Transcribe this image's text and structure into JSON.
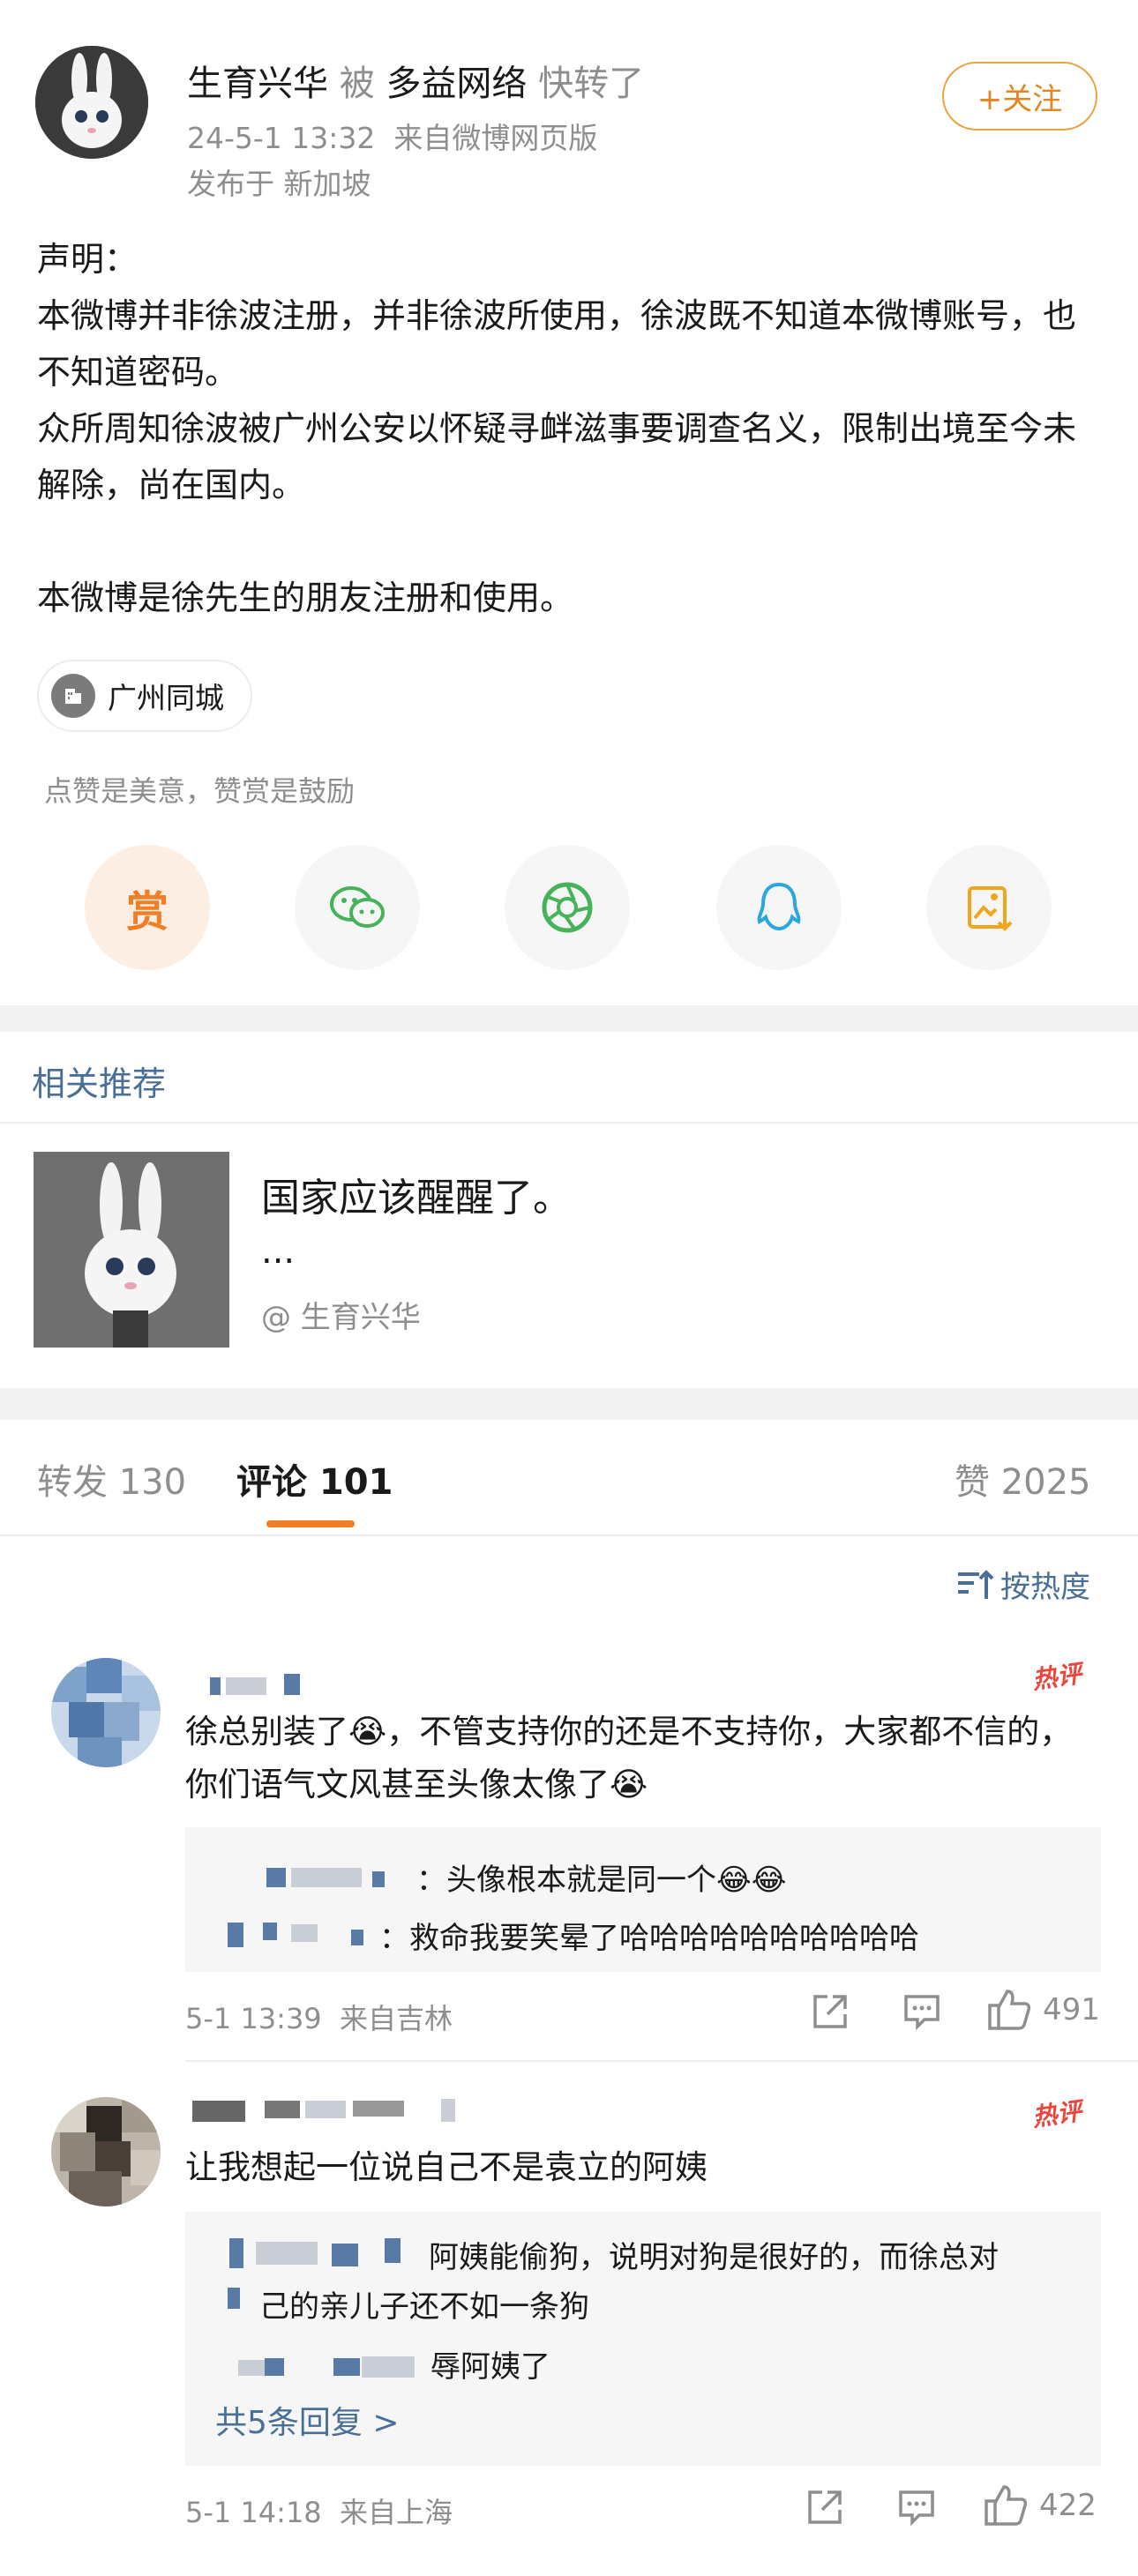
{
  "post": {
    "author": "生育兴华",
    "connector": "被",
    "reposter": "多益网络",
    "action": "快转了",
    "time": "24-5-1 13:32",
    "source": "来自微博网页版",
    "location": "发布于 新加坡",
    "follow_label": "+关注",
    "body": [
      "声明：",
      "本微博并非徐波注册，并非徐波所使用，徐波既不知道本微博账号，也不知道密码。",
      "众所周知徐波被广州公安以怀疑寻衅滋事要调查名义，限制出境至今未解除，尚在国内。",
      "",
      "本微博是徐先生的朋友注册和使用。"
    ],
    "tag": "广州同城",
    "like_hint": "点赞是美意，赞赏是鼓励",
    "reward_label": "赏"
  },
  "recommend": {
    "title": "相关推荐",
    "headline": "国家应该醒醒了。",
    "ellipsis": "...",
    "author": "@ 生育兴华"
  },
  "tabs": {
    "repost": "转发 130",
    "comment": "评论 101",
    "like": "赞 2025",
    "sort_label": "按热度"
  },
  "comments": [
    {
      "hot_label": "热评",
      "text": "徐总别装了😭，不管支持你的还是不支持你，大家都不信的，你们语气文风甚至头像太像了😭",
      "replies": [
        "：头像根本就是同一个😂😂",
        "：救命我要笑晕了哈哈哈哈哈哈哈哈哈哈"
      ],
      "time": "5-1 13:39",
      "source": "来自吉林",
      "likes": "491"
    },
    {
      "hot_label": "热评",
      "text": "让我想起一位说自己不是袁立的阿姨",
      "replies": [
        "阿姨能偷狗，说明对狗是很好的，而徐总对",
        "己的亲儿子还不如一条狗",
        "辱阿姨了"
      ],
      "more_label": "共5条回复 >",
      "time": "5-1 14:18",
      "source": "来自上海",
      "likes": "422"
    }
  ],
  "colors": {
    "accent_orange": "#f17d24",
    "link_blue": "#4a6f96",
    "hot_red": "#e9463c"
  }
}
